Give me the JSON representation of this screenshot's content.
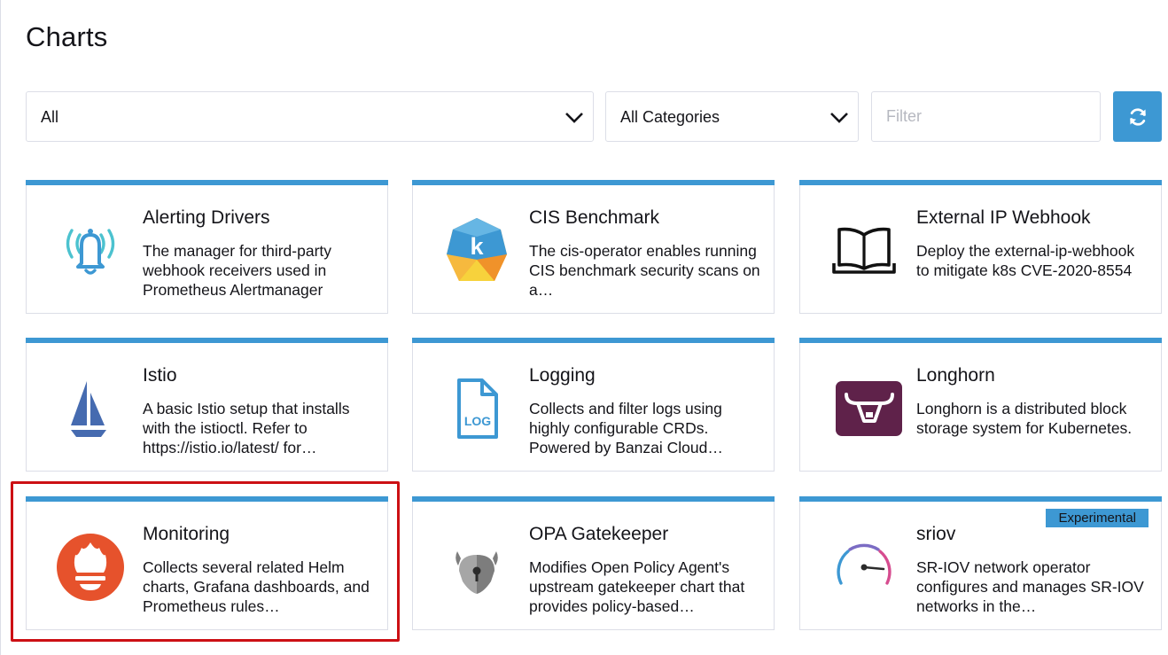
{
  "page": {
    "title": "Charts"
  },
  "toolbar": {
    "repo_select_value": "All",
    "category_select_value": "All Categories",
    "filter_placeholder": "Filter",
    "refresh_icon": "refresh-icon"
  },
  "colors": {
    "accent": "#3d98d3",
    "highlight": "#cc1014",
    "border": "#dcdee7"
  },
  "cards": [
    {
      "title": "Alerting Drivers",
      "desc": "The manager for third-party webhook receivers used in Prometheus Alertmanager",
      "icon": "bell-icon"
    },
    {
      "title": "CIS Benchmark",
      "desc": "The cis-operator enables running CIS benchmark security scans on a…",
      "icon": "cis-benchmark-icon"
    },
    {
      "title": "External IP Webhook",
      "desc": "Deploy the external-ip-webhook to mitigate k8s CVE-2020-8554",
      "icon": "book-icon"
    },
    {
      "title": "Istio",
      "desc": "A basic Istio setup that installs with the istioctl. Refer to https://istio.io/latest/ for…",
      "icon": "istio-sail-icon"
    },
    {
      "title": "Logging",
      "desc": "Collects and filter logs using highly configurable CRDs. Powered by Banzai Cloud…",
      "icon": "log-file-icon",
      "icon_text": "LOG"
    },
    {
      "title": "Longhorn",
      "desc": "Longhorn is a distributed block storage system for Kubernetes.",
      "icon": "longhorn-icon"
    },
    {
      "title": "Monitoring",
      "desc": "Collects several related Helm charts, Grafana dashboards, and Prometheus rules…",
      "icon": "prometheus-icon"
    },
    {
      "title": "OPA Gatekeeper",
      "desc": "Modifies Open Policy Agent's upstream gatekeeper chart that provides policy-based…",
      "icon": "gatekeeper-icon"
    },
    {
      "title": "sriov",
      "desc": "SR-IOV network operator configures and manages SR-IOV networks in the…",
      "icon": "gauge-icon",
      "badge": "Experimental"
    }
  ]
}
